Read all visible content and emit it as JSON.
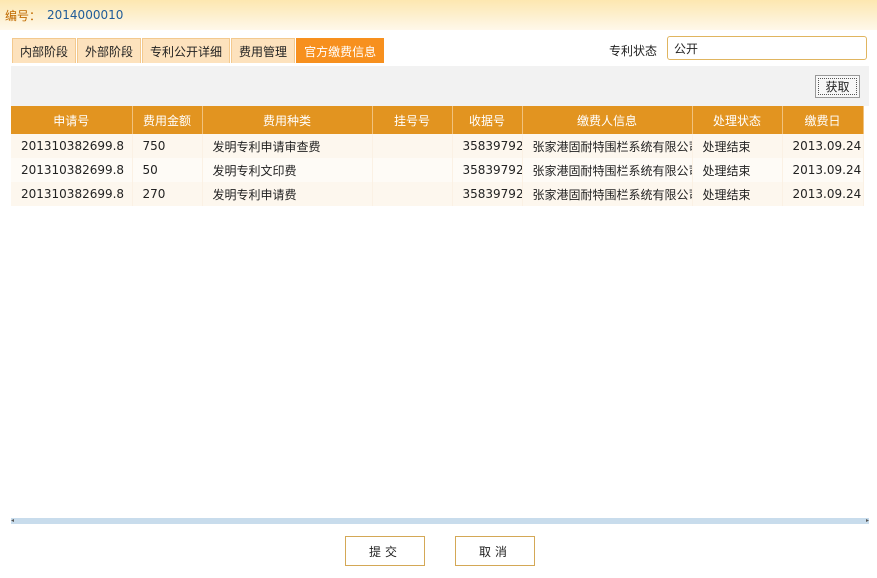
{
  "header": {
    "number_label": "编号：",
    "number_value": "2014000010"
  },
  "tabs": [
    {
      "label": "内部阶段",
      "active": false
    },
    {
      "label": "外部阶段",
      "active": false
    },
    {
      "label": "专利公开详细",
      "active": false
    },
    {
      "label": "费用管理",
      "active": false
    },
    {
      "label": "官方缴费信息",
      "active": true
    }
  ],
  "patent_status": {
    "label": "专利状态",
    "value": "公开"
  },
  "toolbar": {
    "fetch_label": "获取"
  },
  "table": {
    "columns": [
      "申请号",
      "费用金额",
      "费用种类",
      "挂号号",
      "收据号",
      "缴费人信息",
      "处理状态",
      "缴费日"
    ],
    "rows": [
      [
        "201310382699.8",
        "750",
        "发明专利申请审查费",
        "",
        "35839792",
        "张家港固耐特围栏系统有限公司",
        "处理结束",
        "2013.09.24"
      ],
      [
        "201310382699.8",
        "50",
        "发明专利文印费",
        "",
        "35839792",
        "张家港固耐特围栏系统有限公司",
        "处理结束",
        "2013.09.24"
      ],
      [
        "201310382699.8",
        "270",
        "发明专利申请费",
        "",
        "35839792",
        "张家港固耐特围栏系统有限公司",
        "处理结束",
        "2013.09.24"
      ]
    ]
  },
  "footer": {
    "submit_label": "提交",
    "cancel_label": "取消"
  },
  "colors": {
    "accent": "#f7901e",
    "header_bg": "#e29420",
    "tab_bg": "#fde2bd"
  },
  "icons": {
    "scroll_left": "scroll-left-arrow-icon",
    "scroll_right": "scroll-right-arrow-icon"
  }
}
